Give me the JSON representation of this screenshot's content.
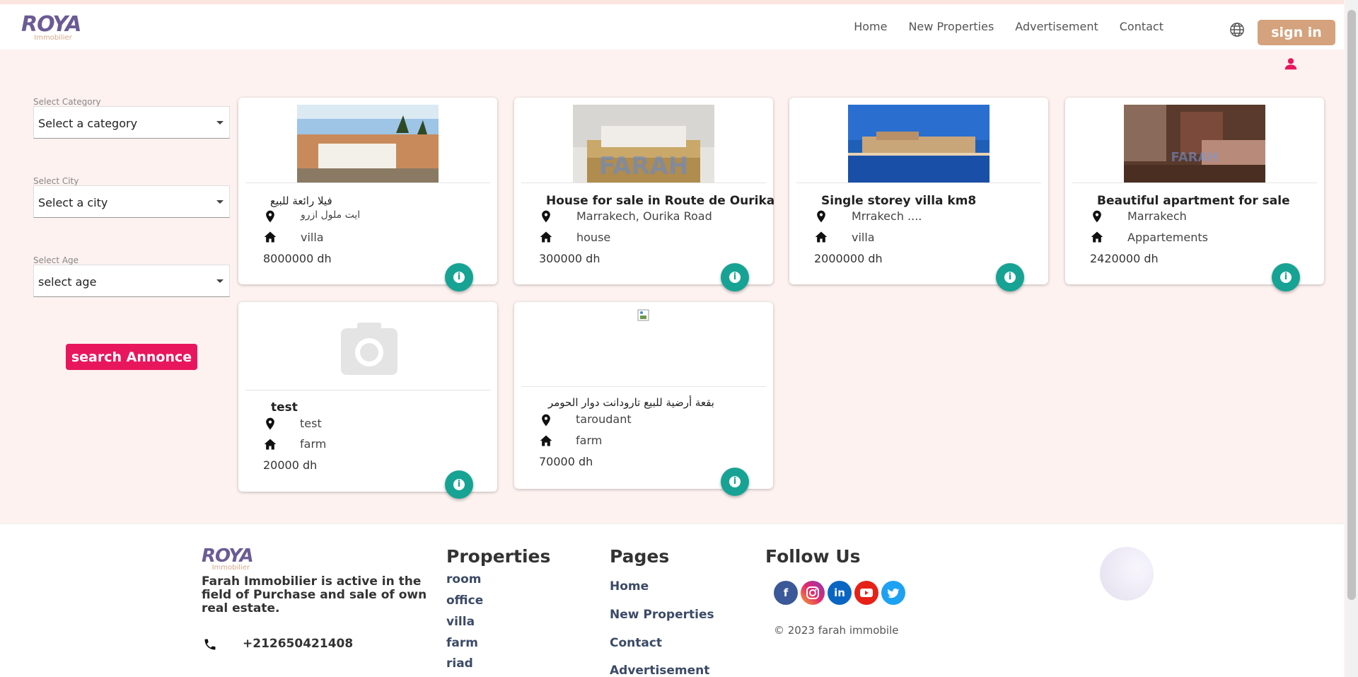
{
  "brand": {
    "logo_main": "ROYA",
    "logo_sub": "Immobilier"
  },
  "nav": {
    "links": [
      "Home",
      "New Properties",
      "Advertisement",
      "Contact"
    ],
    "sign_in": "sign in"
  },
  "filters": {
    "category": {
      "label": "Select Category",
      "value": "Select a category"
    },
    "city": {
      "label": "Select City",
      "value": "Select a city"
    },
    "age": {
      "label": "Select Age",
      "value": "select age"
    },
    "search_button": "search Annonce"
  },
  "cards": [
    {
      "title": "فيلا رائعة للبيع",
      "location": "ايت ملول ازرو",
      "type": "villa",
      "price": "8000000 dh"
    },
    {
      "title": "House for sale in Route de Ourika",
      "location": "Marrakech, Ourika Road",
      "type": "house",
      "price": "300000 dh",
      "watermark": "FARAH"
    },
    {
      "title": "Single storey villa km8",
      "location": "Mrrakech ....",
      "type": "villa",
      "price": "2000000 dh"
    },
    {
      "title": "Beautiful apartment for sale",
      "location": "Marrakech",
      "type": "Appartements",
      "price": "2420000 dh",
      "watermark": "FARAH"
    },
    {
      "title": "test",
      "location": "test",
      "type": "farm",
      "price": "20000 dh"
    },
    {
      "title": "بقعة أرضية للبيع تارودانت دوار الحومر",
      "location": "taroudant",
      "type": "farm",
      "price": "70000 dh"
    }
  ],
  "footer": {
    "description": "Farah Immobilier is active in the field of Purchase and sale of own real estate.",
    "phone": "+212650421408",
    "properties_heading": "Properties",
    "properties": [
      "room",
      "office",
      "villa",
      "farm",
      "riad"
    ],
    "pages_heading": "Pages",
    "pages": [
      "Home",
      "New Properties",
      "Contact",
      "Advertisement"
    ],
    "follow_heading": "Follow Us",
    "social": [
      "facebook",
      "instagram",
      "linkedin",
      "youtube",
      "twitter"
    ],
    "copyright": "© 2023 farah immobile"
  },
  "colors": {
    "accent": "#e8175d",
    "signin": "#d4a27c",
    "info": "#16a394",
    "background": "#fdf2f0"
  }
}
